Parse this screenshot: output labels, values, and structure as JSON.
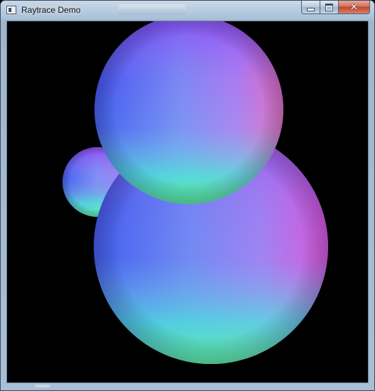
{
  "window": {
    "title": "Raytrace Demo",
    "icon": "app-window-icon",
    "caption_buttons": {
      "minimize": "minimize-icon",
      "maximize": "maximize-icon",
      "close": "close-icon"
    },
    "close_glyph": "✕"
  },
  "scene": {
    "background_color": "#000000",
    "objects": [
      {
        "kind": "sphere",
        "label": "small-back-sphere"
      },
      {
        "kind": "sphere",
        "label": "large-bottom-sphere"
      },
      {
        "kind": "sphere",
        "label": "top-sphere"
      }
    ],
    "shading": "surface-normal",
    "palette": {
      "left_blue": "#3a5cf0",
      "top_purple": "#7a3cf0",
      "right_magenta": "#e23cd8",
      "right_pink": "#f06a9a",
      "bottom_cyan": "#4af0c8",
      "bottom_green": "#52f590",
      "center_periwinkle": "#7f9cf7"
    }
  }
}
